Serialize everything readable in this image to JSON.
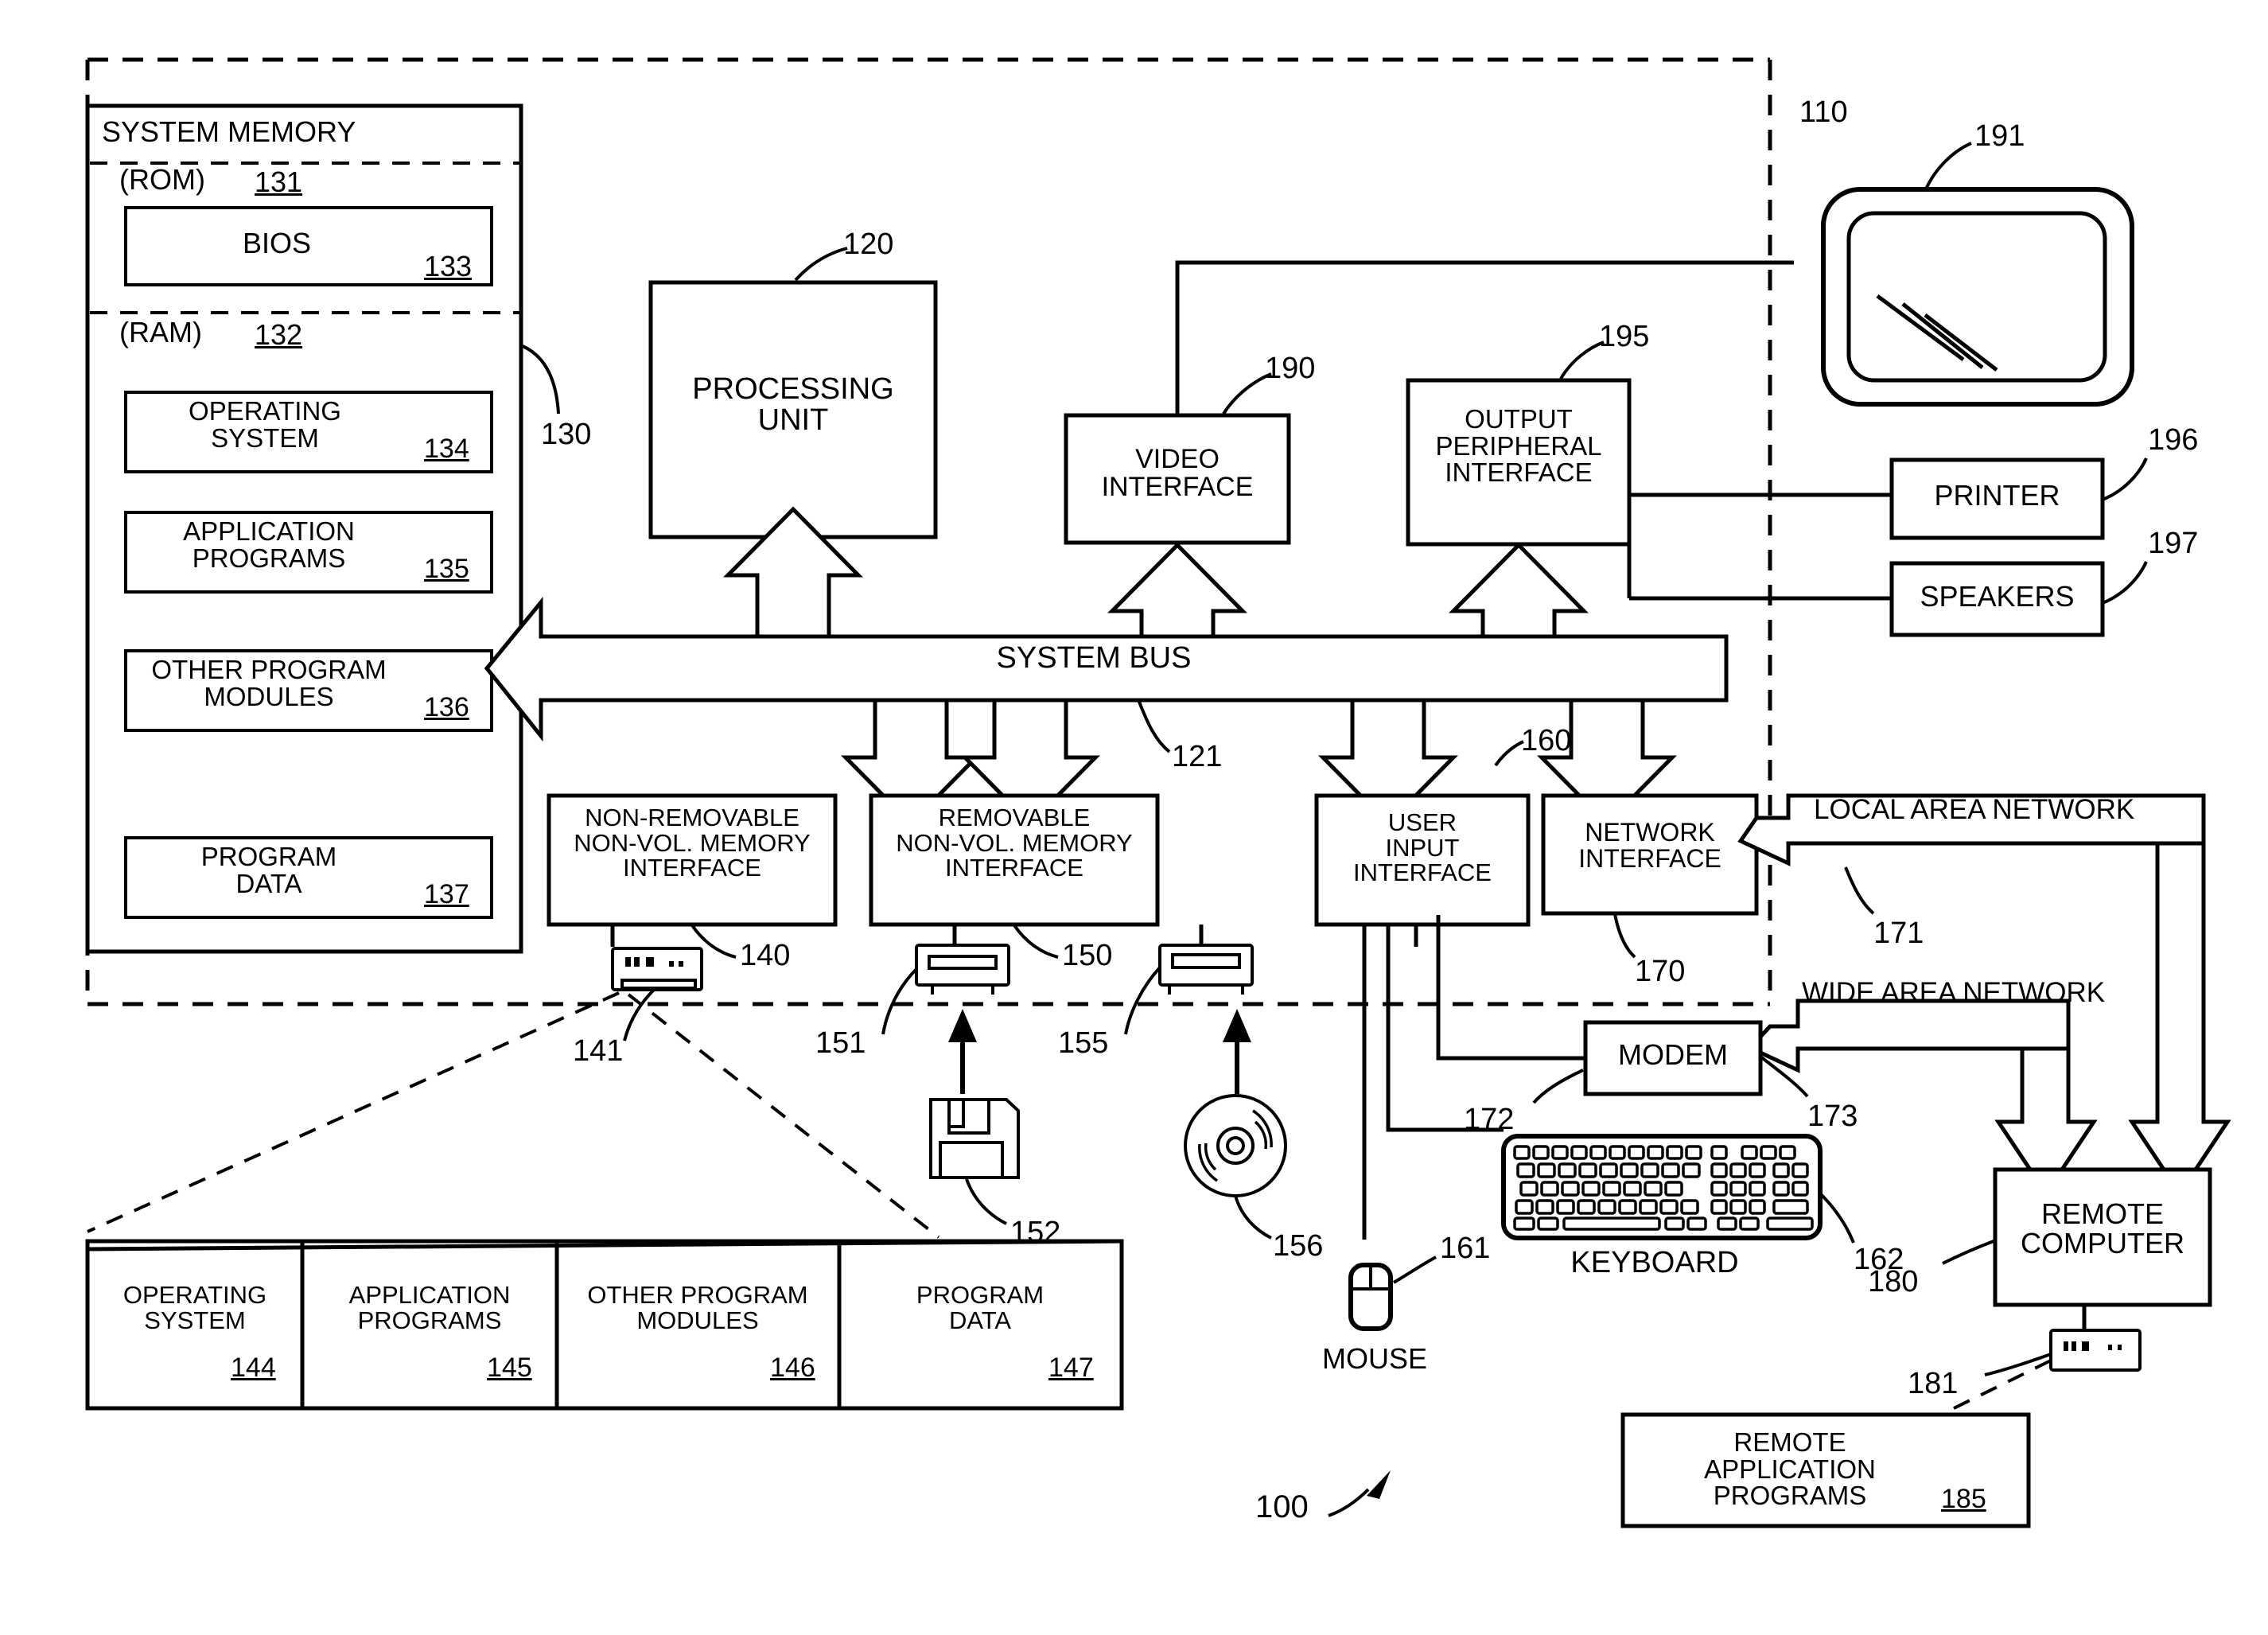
{
  "figure": {
    "name": "computing-environment-block-diagram",
    "figure_ref": "100"
  },
  "computer_boundary": {
    "ref": "110"
  },
  "system_memory": {
    "title": "SYSTEM MEMORY",
    "ref": "130",
    "rom": {
      "label": "(ROM)",
      "ref": "131"
    },
    "ram": {
      "label": "(RAM)",
      "ref": "132"
    },
    "blocks": [
      {
        "label": "BIOS",
        "ref": "133"
      },
      {
        "label": "OPERATING\nSYSTEM",
        "ref": "134"
      },
      {
        "label": "APPLICATION\nPROGRAMS",
        "ref": "135"
      },
      {
        "label": "OTHER PROGRAM\nMODULES",
        "ref": "136"
      },
      {
        "label": "PROGRAM\nDATA",
        "ref": "137"
      }
    ]
  },
  "processing_unit": {
    "label": "PROCESSING\nUNIT",
    "ref": "120"
  },
  "system_bus": {
    "label": "SYSTEM BUS",
    "ref": "121"
  },
  "interfaces": {
    "video": {
      "label": "VIDEO\nINTERFACE",
      "ref": "190"
    },
    "output_peripheral": {
      "label": "OUTPUT\nPERIPHERAL\nINTERFACE",
      "ref": "195"
    },
    "non_removable": {
      "label": "NON-REMOVABLE\nNON-VOL. MEMORY\nINTERFACE",
      "ref": "140"
    },
    "removable": {
      "label": "REMOVABLE\nNON-VOL. MEMORY\nINTERFACE",
      "ref": "150"
    },
    "user_input": {
      "label": "USER\nINPUT\nINTERFACE",
      "ref": "160"
    },
    "network": {
      "label": "NETWORK\nINTERFACE",
      "ref": "170"
    }
  },
  "output_devices": {
    "monitor": {
      "name": "MONITOR",
      "ref": "191"
    },
    "printer": {
      "label": "PRINTER",
      "ref": "196"
    },
    "speakers": {
      "label": "SPEAKERS",
      "ref": "197"
    }
  },
  "storage_devices": {
    "hard_drive": {
      "ref": "141"
    },
    "floppy_drive": {
      "ref": "151"
    },
    "floppy_disk": {
      "ref": "152"
    },
    "optical_drive": {
      "ref": "155"
    },
    "optical_disc": {
      "ref": "156"
    }
  },
  "input_devices": {
    "mouse": {
      "label": "MOUSE",
      "ref": "161"
    },
    "keyboard": {
      "label": "KEYBOARD",
      "ref": "162"
    }
  },
  "networking": {
    "lan_label": "LOCAL AREA NETWORK",
    "lan_ref": "171",
    "wan_label": "WIDE AREA NETWORK",
    "wan_ref": "173",
    "modem": {
      "label": "MODEM",
      "ref": "172"
    },
    "remote_computer": {
      "label": "REMOTE\nCOMPUTER",
      "ref": "180"
    },
    "remote_storage": {
      "ref": "181"
    },
    "remote_application_programs": {
      "label": "REMOTE\nAPPLICATION\nPROGRAMS",
      "ref": "185"
    }
  },
  "hard_disk_contents": {
    "columns": [
      {
        "label": "OPERATING\nSYSTEM",
        "ref": "144"
      },
      {
        "label": "APPLICATION\nPROGRAMS",
        "ref": "145"
      },
      {
        "label": "OTHER PROGRAM\nMODULES",
        "ref": "146"
      },
      {
        "label": "PROGRAM\nDATA",
        "ref": "147"
      }
    ]
  },
  "style": {
    "ink": "#000000",
    "paper": "#ffffff"
  }
}
